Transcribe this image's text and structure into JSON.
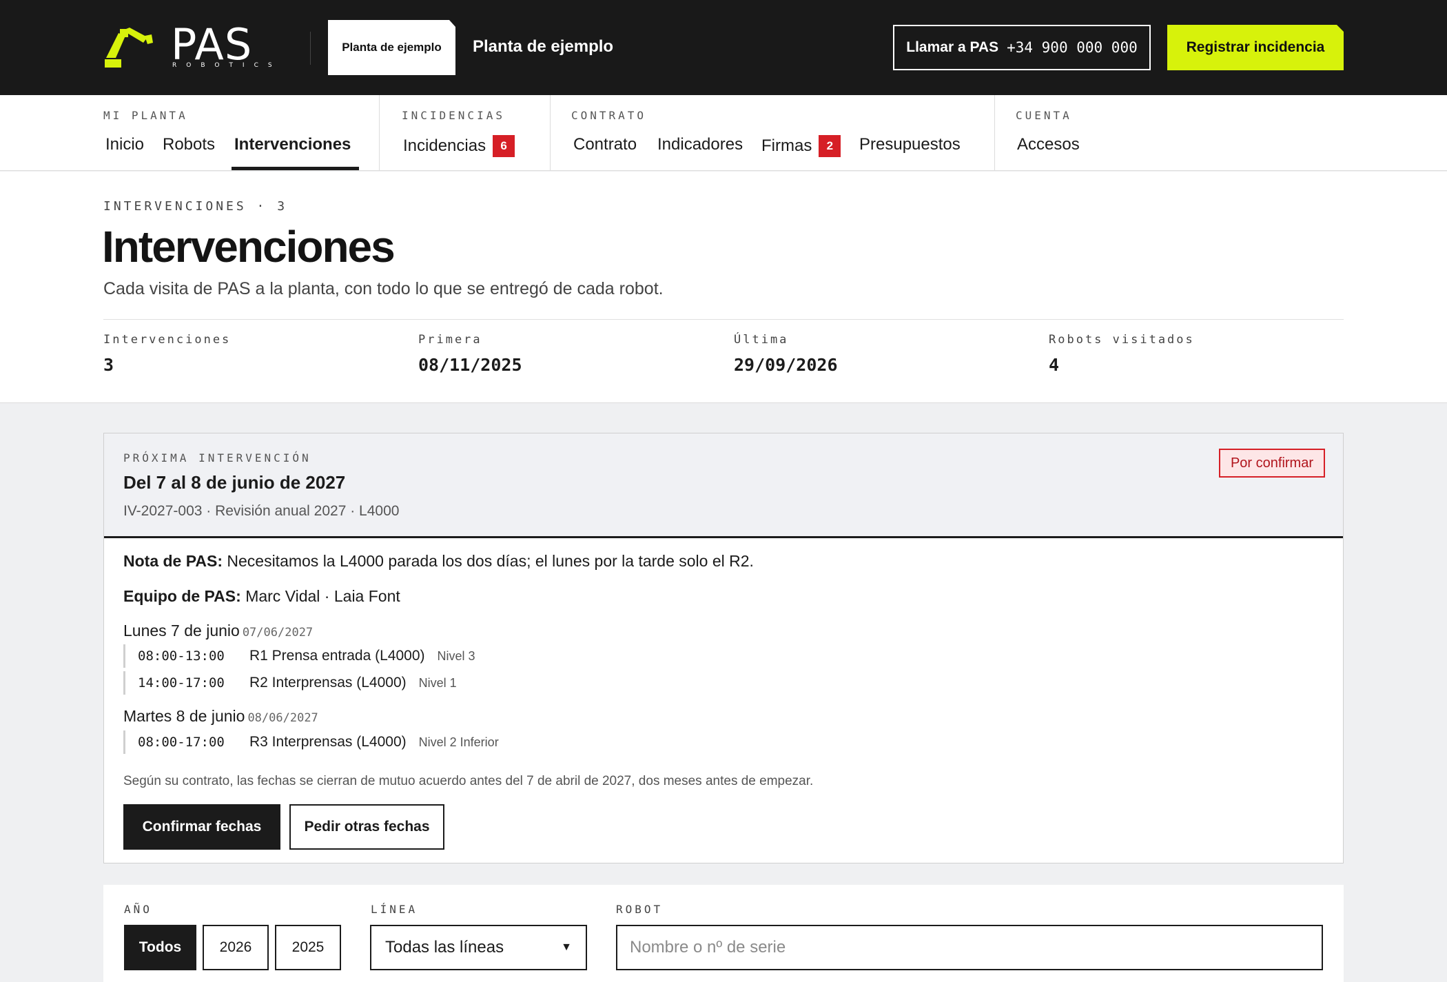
{
  "brand": {
    "logo_text": "PAS",
    "logo_subtext": "ROBOTICS",
    "accent": "#d7f20b"
  },
  "topbar": {
    "plant_tag": "Planta de ejemplo",
    "plant_name": "Planta de ejemplo",
    "call_label": "Llamar a PAS",
    "call_number": "+34 900 000 000",
    "register_label": "Registrar incidencia"
  },
  "nav": {
    "groups": [
      {
        "label": "MI PLANTA",
        "items": [
          "Inicio",
          "Robots",
          "Intervenciones"
        ]
      },
      {
        "label": "INCIDENCIAS",
        "items": [
          "Incidencias"
        ],
        "badge": "6"
      },
      {
        "label": "CONTRATO",
        "items": [
          "Contrato",
          "Indicadores",
          "Firmas",
          "Presupuestos"
        ],
        "badge": "2"
      },
      {
        "label": "CUENTA",
        "items": [
          "Accesos"
        ]
      }
    ],
    "active": "Intervenciones"
  },
  "header": {
    "eyebrow": "INTERVENCIONES · 3",
    "title": "Intervenciones",
    "subtitle": "Cada visita de PAS a la planta, con todo lo que se entregó de cada robot.",
    "stats": [
      {
        "label": "Intervenciones",
        "value": "3"
      },
      {
        "label": "Primera",
        "value": "08/11/2025"
      },
      {
        "label": "Última",
        "value": "29/09/2026"
      },
      {
        "label": "Robots visitados",
        "value": "4"
      }
    ]
  },
  "next": {
    "eyebrow": "PRÓXIMA INTERVENCIÓN",
    "title": "Del 7 al 8 de junio de 2027",
    "meta": "IV-2027-003 · Revisión anual 2027 · L4000",
    "status": "Por confirmar",
    "note_label": "Nota de PAS:",
    "note_text": "Necesitamos la L4000 parada los dos días; el lunes por la tarde solo el R2.",
    "team_label": "Equipo de PAS:",
    "team_text": "Marc Vidal · Laia Font",
    "days": [
      {
        "title": "Lunes 7 de junio",
        "date": "07/06/2027",
        "slots": [
          {
            "time": "08:00-13:00",
            "robot": "R1 Prensa entrada (L4000)",
            "level": "Nivel 3"
          },
          {
            "time": "14:00-17:00",
            "robot": "R2 Interprensas (L4000)",
            "level": "Nivel 1"
          }
        ]
      },
      {
        "title": "Martes 8 de junio",
        "date": "08/06/2027",
        "slots": [
          {
            "time": "08:00-17:00",
            "robot": "R3 Interprensas (L4000)",
            "level": "Nivel 2 Inferior"
          }
        ]
      }
    ],
    "contract_note": "Según su contrato, las fechas se cierran de mutuo acuerdo antes del 7 de abril de 2027, dos meses antes de empezar.",
    "confirm_label": "Confirmar fechas",
    "request_label": "Pedir otras fechas"
  },
  "filters": {
    "year_label": "AÑO",
    "years": [
      "Todos",
      "2026",
      "2025"
    ],
    "line_label": "LÍNEA",
    "line_value": "Todas las líneas",
    "robot_label": "ROBOT",
    "robot_placeholder": "Nombre o nº de serie"
  }
}
